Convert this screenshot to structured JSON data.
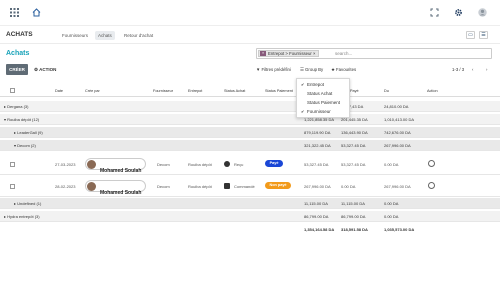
{
  "topbar": {
    "grid_icon": "apps-grid-icon",
    "home_icon": "home-icon",
    "expand_icon": "expand-icon",
    "settings_icon": "gear-icon",
    "avatar_icon": "user-avatar-icon"
  },
  "subnav": {
    "title": "ACHATS",
    "tabs": [
      "Fournisseurs",
      "Achats",
      "Retour d'achat"
    ],
    "active_tab": "Achats"
  },
  "control_panel": {
    "breadcrumb": "Achats",
    "create_label": "CRÉER",
    "action_label": "ACTION",
    "search": {
      "facet": "Entrepot > Fournisseur",
      "placeholder": "search..."
    },
    "filters_label": "Filtres prédéfini",
    "groupby_label": "Group By",
    "favorites_label": "Favourites",
    "pager": "1-3 / 3"
  },
  "groupby_menu": [
    {
      "label": "Entrepot",
      "checked": true
    },
    {
      "label": "Status Achat",
      "checked": false
    },
    {
      "label": "Status Paiement",
      "checked": false
    },
    {
      "label": "Fournisseur",
      "checked": true
    }
  ],
  "table": {
    "headers": [
      "Date",
      "Crée par",
      "Fournisseur",
      "Entrepot",
      "Status Achat",
      "Status Paiement",
      "Payé",
      "Du",
      "Action"
    ],
    "groups": [
      {
        "label": "▸ Dergana (3)",
        "total": "1,092,433 DA",
        "paid": "1,017,43 DA",
        "due": "24,810.00 DA",
        "level": 0
      },
      {
        "label": "▾ Rouiba dépôt (12)",
        "total": "1,221,858.35 DA",
        "paid": "201,445.35 DA",
        "due": "1,010,413.00 DA",
        "level": 0
      },
      {
        "label": "▸ LeaderGall (9)",
        "total": "879,119.90 DA",
        "paid": "136,443.90 DA",
        "due": "742,676.00 DA",
        "level": 1
      },
      {
        "label": "▾ Decom (2)",
        "total": "321,322.45 DA",
        "paid": "53,327.45 DA",
        "due": "267,996.00 DA",
        "level": 1
      }
    ],
    "records": [
      {
        "date": "27-03-2023",
        "creator": "Mohamed Soulah",
        "supplier": "Decom",
        "warehouse": "Rouiba dépôt",
        "status_achat": "Reçu",
        "status_achat_color": "#333333",
        "status_paiement": "Payé",
        "status_paiement_color": "#1a47d6",
        "total": "53,327.45 DA",
        "paid": "53,327.45 DA",
        "due": "0.00 DA"
      },
      {
        "date": "28-02-2023",
        "creator": "Mohamed Soulah",
        "supplier": "Decom",
        "warehouse": "Rouiba dépôt",
        "status_achat": "Commandé",
        "status_achat_color": "#333333",
        "status_paiement": "Non payé",
        "status_paiement_color": "#f29a1a",
        "total": "267,996.00 DA",
        "paid": "0.00 DA",
        "due": "267,996.00 DA"
      }
    ],
    "tail_groups": [
      {
        "label": "▸ Undefined (1)",
        "total": "11,115.00 DA",
        "paid": "11,115.00 DA",
        "due": "0.00 DA",
        "level": 1
      },
      {
        "label": "▸ Hydra entrepôt (3)",
        "total": "86,799.00 DA",
        "paid": "86,799.00 DA",
        "due": "0.00 DA",
        "level": 0
      }
    ],
    "grand_total": {
      "total": "1,354,164.58 DA",
      "paid": "318,591.58 DA",
      "due": "1,035,573.00 DA"
    }
  }
}
